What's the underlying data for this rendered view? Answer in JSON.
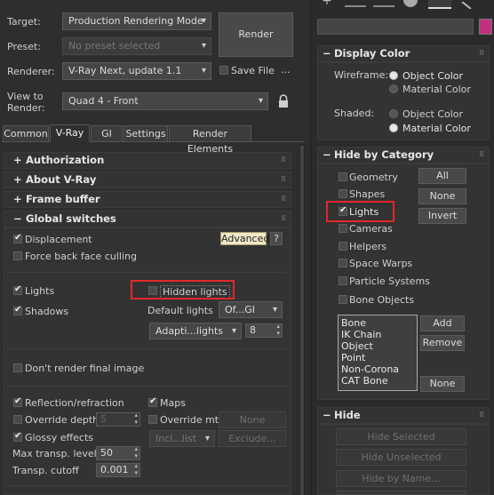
{
  "render_dialog": {
    "target_label": "Target:",
    "target_value": "Production Rendering Mode",
    "preset_label": "Preset:",
    "preset_value": "No preset selected",
    "renderer_label": "Renderer:",
    "renderer_value": "V-Ray Next, update 1.1",
    "view_label_1": "View to",
    "view_label_2": "Render:",
    "view_value": "Quad 4 - Front",
    "render_button": "Render",
    "save_file_label": "Save File",
    "ellipsis": "..."
  },
  "tabs": [
    "Common",
    "V-Ray",
    "GI",
    "Settings",
    "Render Elements"
  ],
  "rollouts": {
    "authorization": "Authorization",
    "about": "About V-Ray",
    "frame_buffer": "Frame buffer",
    "global_switches": "Global switches"
  },
  "global_switches": {
    "displacement": "Displacement",
    "advanced": "Advanced",
    "help": "?",
    "force_back_face": "Force back face culling",
    "lights": "Lights",
    "hidden_lights": "Hidden lights",
    "shadows": "Shadows",
    "default_lights_label": "Default lights",
    "default_lights_value": "Of...GI",
    "adaptive_value": "Adapti...lights",
    "adaptive_num": "8",
    "dont_render": "Don't render final image",
    "reflection": "Reflection/refraction",
    "maps": "Maps",
    "override_depth": "Override depth",
    "override_depth_val": "5",
    "override_mtl": "Override mtl",
    "none_btn": "None",
    "glossy": "Glossy effects",
    "incl_list": "Incl...list",
    "exclude": "Exclude...",
    "max_transp_label": "Max transp. levels",
    "max_transp_val": "50",
    "transp_cutoff_label": "Transp. cutoff",
    "transp_cutoff_val": "0.001"
  },
  "display_panel": {
    "display_color_title": "Display Color",
    "wireframe_label": "Wireframe:",
    "shaded_label": "Shaded:",
    "object_color": "Object Color",
    "material_color": "Material Color",
    "hide_by_category_title": "Hide by Category",
    "categories": [
      "Geometry",
      "Shapes",
      "Lights",
      "Cameras",
      "Helpers",
      "Space Warps",
      "Particle Systems",
      "Bone Objects"
    ],
    "all_btn": "All",
    "none_btn": "None",
    "invert_btn": "Invert",
    "list_items": [
      "Bone",
      "IK Chain Object",
      "Point",
      "Non-Corona",
      "CAT Bone"
    ],
    "add_btn": "Add",
    "remove_btn": "Remove",
    "none_btn2": "None",
    "hide_title": "Hide",
    "hide_selected": "Hide Selected",
    "hide_unselected": "Hide Unselected",
    "hide_by_name": "Hide by Name..."
  },
  "colors": {
    "highlight_red": "#e0282c",
    "swatch_magenta": "#c2317d"
  }
}
